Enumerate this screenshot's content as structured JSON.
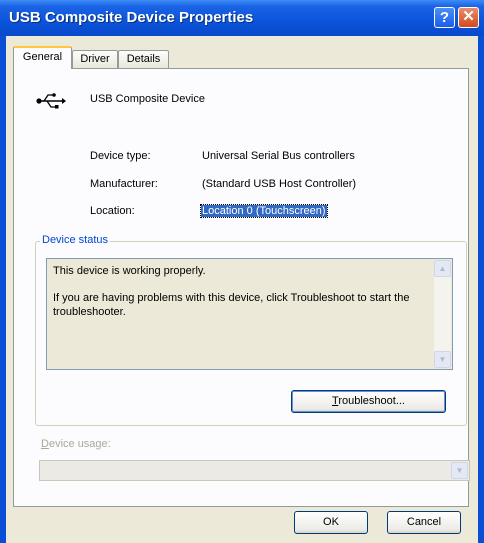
{
  "window": {
    "title": "USB Composite Device Properties",
    "help_glyph": "?",
    "close_glyph": "✕"
  },
  "tabs": [
    {
      "label": "General",
      "active": true
    },
    {
      "label": "Driver",
      "active": false
    },
    {
      "label": "Details",
      "active": false
    }
  ],
  "device": {
    "icon": "usb-icon",
    "name": "USB Composite Device",
    "properties": [
      {
        "label": "Device type:",
        "value": "Universal Serial Bus controllers"
      },
      {
        "label": "Manufacturer:",
        "value": "(Standard USB Host Controller)"
      },
      {
        "label": "Location:",
        "value": "Location 0 (Touchscreen)"
      }
    ]
  },
  "status": {
    "legend": "Device status",
    "line1": "This device is working properly.",
    "line2": "If you are having problems with this device, click Troubleshoot to start the troubleshooter.",
    "troubleshoot_rest": "roubleshoot...",
    "troubleshoot_accel": "T"
  },
  "usage": {
    "label_accel": "D",
    "label_rest": "evice usage:",
    "value": ""
  },
  "buttons": {
    "ok": "OK",
    "cancel": "Cancel"
  },
  "colors": {
    "titlebar": "#0b54da",
    "dialog_bg": "#ece9d8",
    "accent": "#0046d5",
    "selection": "#316ac5"
  }
}
